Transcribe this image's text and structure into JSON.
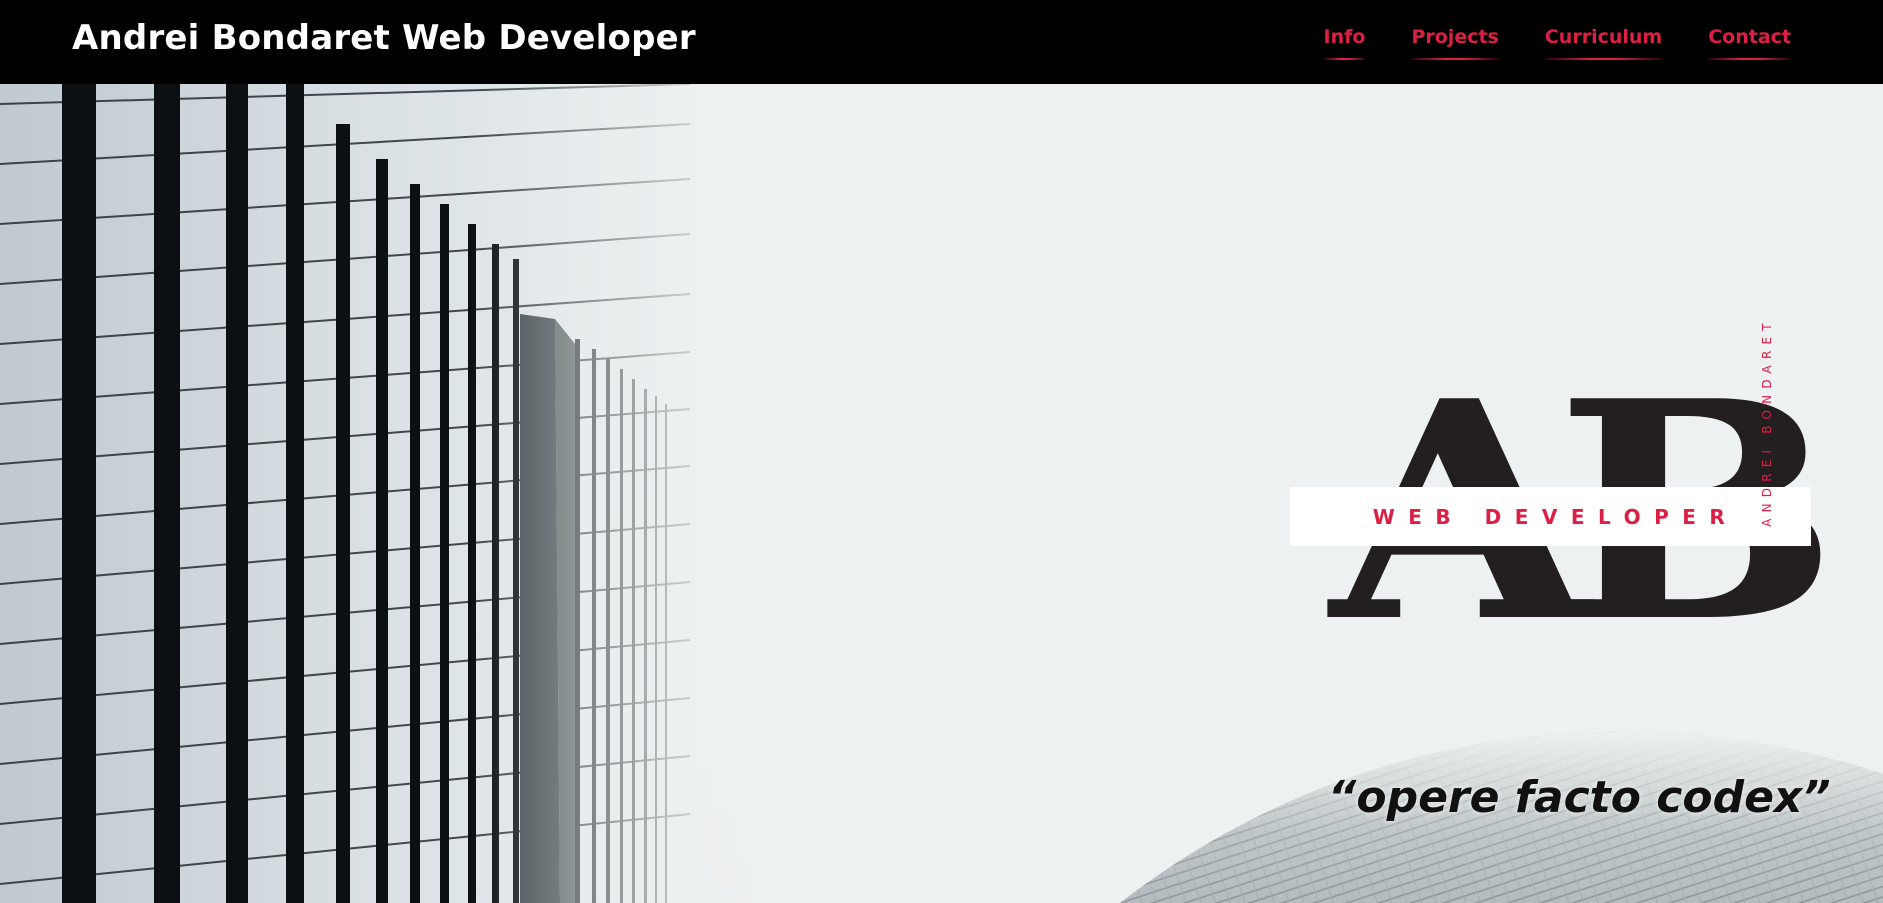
{
  "header": {
    "brand": "Andrei Bondaret Web Developer",
    "nav": [
      {
        "label": "Info"
      },
      {
        "label": "Projects"
      },
      {
        "label": "Curriculum"
      },
      {
        "label": "Contact"
      }
    ]
  },
  "hero": {
    "logo": {
      "letters": "AB",
      "tagline": "WEB DEVELOPER",
      "vertical_name": "ANDREI BONDARET"
    },
    "quote": "“opere facto codex”"
  },
  "colors": {
    "header_bg": "#000000",
    "accent": "#dc1f45",
    "logo_dark": "#231f20",
    "hero_bg": "#eef1f1"
  }
}
